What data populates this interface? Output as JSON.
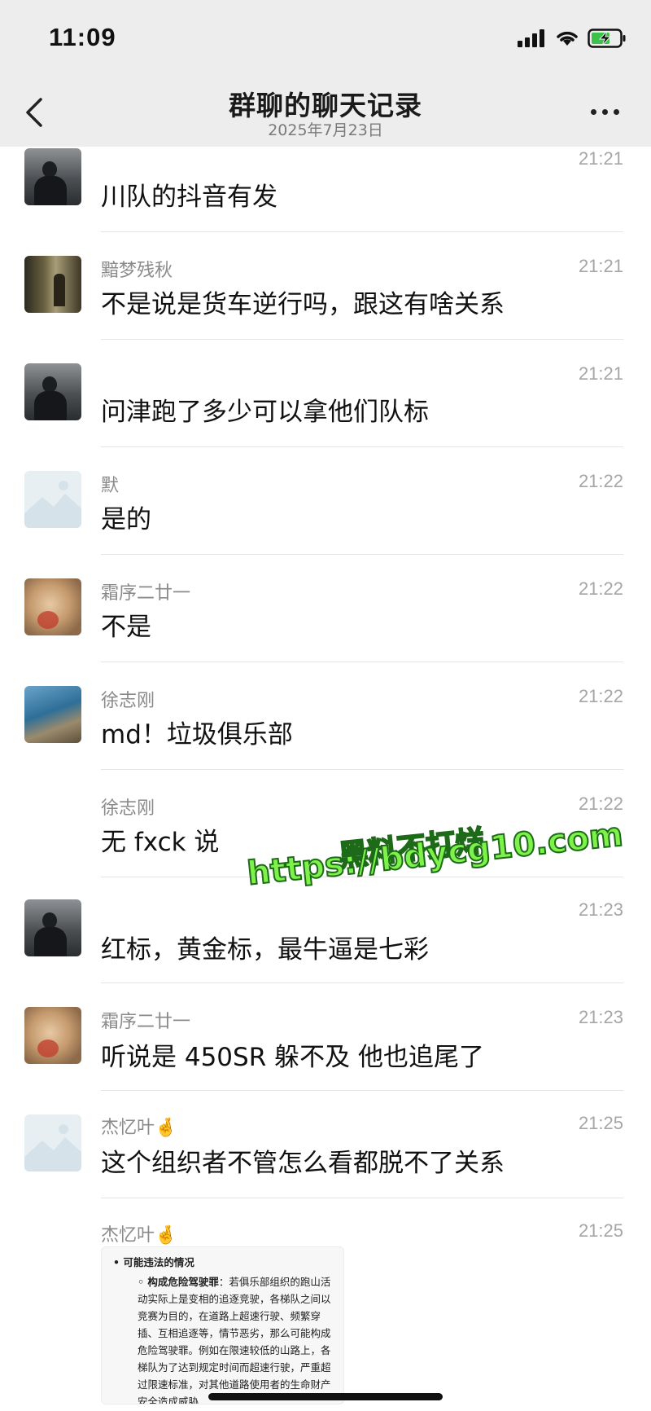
{
  "status_bar": {
    "time": "11:09"
  },
  "nav": {
    "title": "群聊的聊天记录",
    "subtitle": "2025年7月23日"
  },
  "messages": [
    {
      "sender": "",
      "time": "21:21",
      "text": "川队的抖音有发",
      "avatar": "man-silhouette"
    },
    {
      "sender": "黯梦残秋",
      "time": "21:21",
      "text": "不是说是货车逆行吗，跟这有啥关系",
      "avatar": "window-figure"
    },
    {
      "sender": "",
      "time": "21:21",
      "text": "问津跑了多少可以拿他们队标",
      "avatar": "man-silhouette"
    },
    {
      "sender": "默",
      "time": "21:22",
      "text": "是的",
      "avatar": "placeholder-image"
    },
    {
      "sender": "霜序二廿一",
      "time": "21:22",
      "text": "不是",
      "avatar": "cat"
    },
    {
      "sender": "徐志刚",
      "time": "21:22",
      "text": "md！垃圾俱乐部",
      "avatar": "seaside"
    },
    {
      "sender": "徐志刚",
      "time": "21:22",
      "text": "无 fxck 说",
      "avatar": ""
    },
    {
      "sender": "",
      "time": "21:23",
      "text": "红标，黄金标，最牛逼是七彩",
      "avatar": "man-silhouette"
    },
    {
      "sender": "霜序二廿一",
      "time": "21:23",
      "text": "听说是 450SR 躲不及 他也追尾了",
      "avatar": "cat"
    },
    {
      "sender": "杰忆叶🤞",
      "time": "21:25",
      "text": "这个组织者不管怎么看都脱不了关系",
      "avatar": "placeholder-image"
    },
    {
      "sender": "杰忆叶🤞",
      "time": "21:25",
      "text": "",
      "avatar": ""
    }
  ],
  "card": {
    "heading": "• 可能违法的情况",
    "subheading": "◦ 构成危险驾驶罪",
    "body": "：若俱乐部组织的跑山活动实际上是变相的追逐竞驶，各梯队之间以竞赛为目的，在道路上超速行驶、频繁穿插、互相追逐等，情节恶劣，那么可能构成危险驾驶罪。例如在限速较低的山路上，各梯队为了达到规定时间而超速行驶，严重超过限速标准，对其他道路使用者的生命财产安全造成威胁"
  },
  "watermark": {
    "line1": "黑料不打烊",
    "line2": "https://bdycg10.com"
  },
  "colors": {
    "nav_bg": "#ededed",
    "divider": "#e4e4e4",
    "watermark": "#7ef24b"
  }
}
